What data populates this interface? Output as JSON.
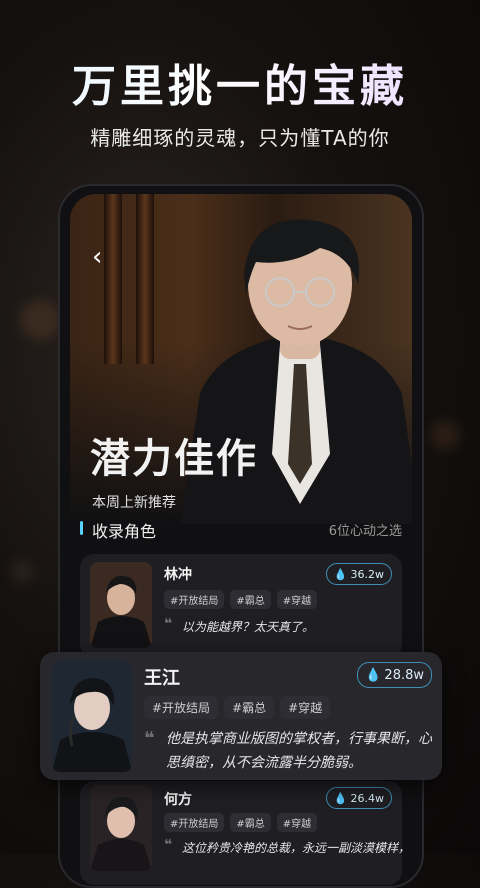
{
  "promo": {
    "headline": "万里挑一的宝藏",
    "subline": "精雕细琢的灵魂，只为懂TA的你"
  },
  "screen": {
    "back_icon": "chevron-left-icon",
    "hero_title": "潜力佳作",
    "hero_subtitle": "本周上新推荐",
    "section_title": "收录角色",
    "section_count": "6位心动之选",
    "accent_color": "#5ad0ff"
  },
  "characters": [
    {
      "name": "林冲",
      "heat": "36.2w",
      "tags": [
        "#开放结局",
        "#霸总",
        "#穿越"
      ],
      "quote": "以为能越界？太天真了。"
    },
    {
      "name": "王江",
      "heat": "28.8w",
      "tags": [
        "#开放结局",
        "#霸总",
        "#穿越"
      ],
      "quote_line1": "他是执掌商业版图的掌权者，行事果断，心",
      "quote_line2": "思缜密，从不会流露半分脆弱。"
    },
    {
      "name": "何方",
      "heat": "26.4w",
      "tags": [
        "#开放结局",
        "#霸总",
        "#穿越"
      ],
      "quote": "这位矜贵冷艳的总裁，永远一副淡漠模样，"
    }
  ]
}
